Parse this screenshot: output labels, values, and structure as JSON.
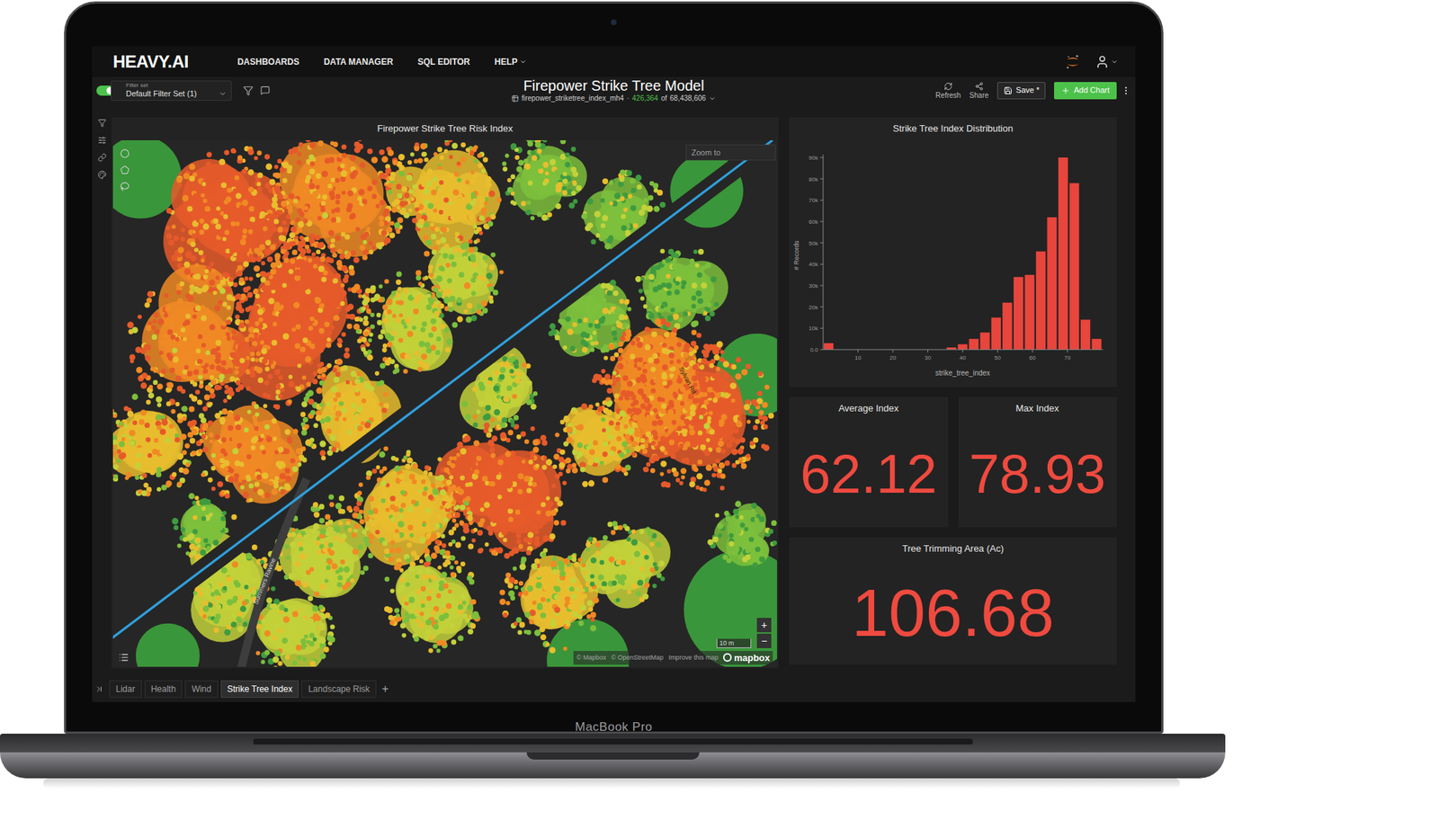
{
  "device": {
    "label": "MacBook Pro"
  },
  "nav": {
    "logo": "HEAVY.AI",
    "menu": [
      {
        "label": "DASHBOARDS",
        "dropdown": false
      },
      {
        "label": "DATA MANAGER",
        "dropdown": false
      },
      {
        "label": "SQL EDITOR",
        "dropdown": false
      },
      {
        "label": "HELP",
        "dropdown": true
      }
    ]
  },
  "toolbar": {
    "filter_set_label": "Filter set",
    "filter_set": "Default Filter Set (1)",
    "filters_on": true,
    "title": "Firepower Strike Tree Model",
    "source": {
      "table": "firepower_striketree_index_mh4",
      "separator": "·",
      "filtered": "426,364",
      "of": "of",
      "total": "68,438,606"
    },
    "actions": [
      {
        "label": "Refresh"
      },
      {
        "label": "Share"
      }
    ],
    "save": "Save *",
    "add_chart": "Add Chart"
  },
  "map": {
    "title": "Firepower Strike Tree Risk Index",
    "zoom_placeholder": "Zoom to",
    "street_labels": [
      "Summers Ravine",
      "Sylvan Rd"
    ],
    "scale": "10 m",
    "zoom_in": "+",
    "zoom_out": "−",
    "attribution": [
      "© Mapbox",
      "© OpenStreetMap",
      "Improve this map"
    ],
    "brand": "mapbox"
  },
  "histogram": {
    "title": "Strike Tree Index Distribution",
    "y_label": "# Records",
    "x_label": "strike_tree_index",
    "y_ticks": [
      {
        "label": "0.0",
        "value": 0
      },
      {
        "label": "10k",
        "value": 10000
      },
      {
        "label": "20k",
        "value": 20000
      },
      {
        "label": "30k",
        "value": 30000
      },
      {
        "label": "40k",
        "value": 40000
      },
      {
        "label": "50k",
        "value": 50000
      },
      {
        "label": "60k",
        "value": 60000
      },
      {
        "label": "70k",
        "value": 70000
      },
      {
        "label": "80k",
        "value": 80000
      },
      {
        "label": "90k",
        "value": 90000
      }
    ],
    "x_ticks": [
      {
        "label": "10",
        "value": 10
      },
      {
        "label": "20",
        "value": 20
      },
      {
        "label": "30",
        "value": 30
      },
      {
        "label": "40",
        "value": 40
      },
      {
        "label": "50",
        "value": 50
      },
      {
        "label": "60",
        "value": 60
      },
      {
        "label": "70",
        "value": 70
      }
    ],
    "values": [
      3000,
      0,
      0,
      0,
      0,
      0,
      0,
      0,
      0,
      0,
      0,
      1000,
      2500,
      5000,
      8000,
      15000,
      22000,
      34000,
      35000,
      46000,
      62000,
      90000,
      78000,
      14000,
      5000
    ]
  },
  "kpis": [
    {
      "title": "Average Index",
      "value": "62.12"
    },
    {
      "title": "Max Index",
      "value": "78.93"
    },
    {
      "title": "Tree Trimming Area (Ac)",
      "value": "106.68"
    }
  ],
  "tabs": [
    {
      "label": "Lidar",
      "selected": false
    },
    {
      "label": "Health",
      "selected": false
    },
    {
      "label": "Wind",
      "selected": false
    },
    {
      "label": "Strike Tree Index",
      "selected": true
    },
    {
      "label": "Landscape Risk",
      "selected": false
    }
  ],
  "add_tab": "+"
}
